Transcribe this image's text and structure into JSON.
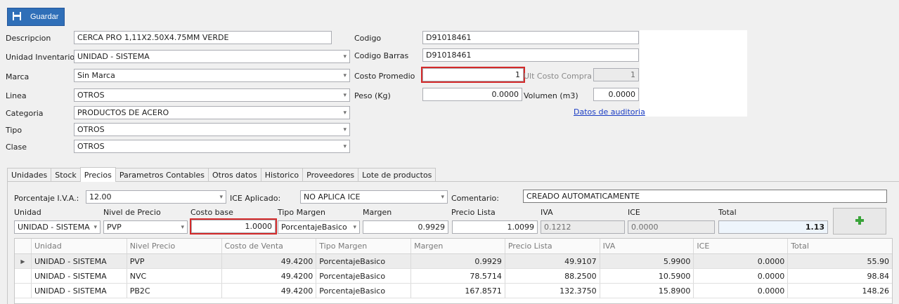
{
  "toolbar": {
    "save_label": "Guardar"
  },
  "form": {
    "descripcion": {
      "label": "Descripcion",
      "value": "CERCA PRO 1,11X2.50X4.75MM VERDE"
    },
    "unidad_inventario": {
      "label": "Unidad Inventario",
      "value": "UNIDAD - SISTEMA"
    },
    "marca": {
      "label": "Marca",
      "value": "Sin Marca"
    },
    "linea": {
      "label": "Linea",
      "value": "OTROS"
    },
    "categoria": {
      "label": "Categoria",
      "value": "PRODUCTOS DE ACERO"
    },
    "tipo": {
      "label": "Tipo",
      "value": "OTROS"
    },
    "clase": {
      "label": "Clase",
      "value": "OTROS"
    },
    "codigo": {
      "label": "Codigo",
      "value": "D91018461"
    },
    "codigo_barras": {
      "label": "Codigo Barras",
      "value": "D91018461"
    },
    "costo_promedio": {
      "label": "Costo Promedio",
      "value": "1"
    },
    "ult_costo_compra": {
      "label": "Ult Costo Compra",
      "value": "1"
    },
    "peso": {
      "label": "Peso (Kg)",
      "value": "0.0000"
    },
    "volumen": {
      "label": "Volumen (m3)",
      "value": "0.0000"
    },
    "auditoria_link": "Datos de auditoria"
  },
  "tabs": [
    "Unidades",
    "Stock",
    "Precios",
    "Parametros Contables",
    "Otros datos",
    "Historico",
    "Proveedores",
    "Lote de productos"
  ],
  "precios": {
    "iva_label": "Porcentaje I.V.A.:",
    "iva_value": "12.00",
    "ice_label": "ICE Aplicado:",
    "ice_value": "NO APLICA ICE",
    "comentario_label": "Comentario:",
    "comentario_value": "CREADO AUTOMATICAMENTE",
    "labels": {
      "unidad": "Unidad",
      "nivel": "Nivel de Precio",
      "costo_base": "Costo base",
      "tipo_margen": "Tipo Margen",
      "margen": "Margen",
      "precio_lista": "Precio Lista",
      "iva": "IVA",
      "ice": "ICE",
      "total": "Total"
    },
    "inputs": {
      "unidad": "UNIDAD - SISTEMA",
      "nivel": "PVP",
      "costo_base": "1.0000",
      "tipo_margen": "PorcentajeBasico",
      "margen": "0.9929",
      "precio_lista": "1.0099",
      "iva": "0.1212",
      "ice": "0.0000",
      "total": "1.13"
    }
  },
  "grid": {
    "headers": [
      "Unidad",
      "Nivel Precio",
      "Costo de Venta",
      "Tipo Margen",
      "Margen",
      "Precio Lista",
      "IVA",
      "ICE",
      "Total"
    ],
    "rows": [
      [
        "UNIDAD - SISTEMA",
        "PVP",
        "49.4200",
        "PorcentajeBasico",
        "0.9929",
        "49.9107",
        "5.9900",
        "0.0000",
        "55.90"
      ],
      [
        "UNIDAD - SISTEMA",
        "NVC",
        "49.4200",
        "PorcentajeBasico",
        "78.5714",
        "88.2500",
        "10.5900",
        "0.0000",
        "98.84"
      ],
      [
        "UNIDAD - SISTEMA",
        "PB2C",
        "49.4200",
        "PorcentajeBasico",
        "167.8571",
        "132.3750",
        "15.8900",
        "0.0000",
        "148.26"
      ]
    ]
  },
  "colors": {
    "accent": "#2f6fb8",
    "highlight": "#d42a2a",
    "link": "#1a3cc4"
  }
}
